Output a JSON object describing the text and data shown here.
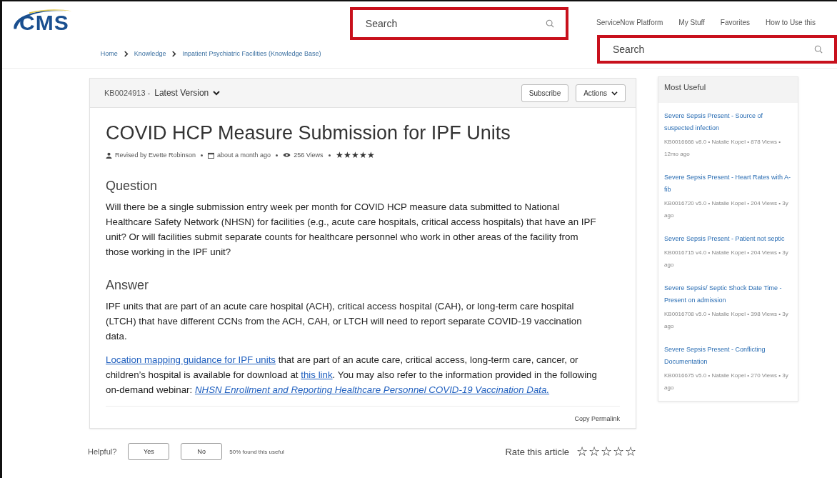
{
  "header": {
    "logo": "CMS",
    "search": {
      "placeholder": "Search"
    },
    "nav": [
      "ServiceNow Platform",
      "My Stuff",
      "Favorites",
      "How to Use this"
    ],
    "search2": {
      "placeholder": "Search"
    }
  },
  "breadcrumbs": [
    "Home",
    "Knowledge",
    "Inpatient Psychiatric Facilities (Knowledge Base)"
  ],
  "article": {
    "number": "KB0024913 -",
    "version": "Latest Version",
    "buttons": [
      "Subscribe",
      "Actions"
    ],
    "title": "COVID HCP Measure Submission for IPF Units",
    "meta": {
      "author": "Revised by Evette Robinson",
      "date": "about a month ago",
      "views": "256 Views",
      "stars": 5
    },
    "sections": [
      {
        "heading": "Question",
        "paragraphs": [
          [
            {
              "kind": "text",
              "text": "Will there be a single submission entry week per month for COVID HCP measure data submitted to National Healthcare Safety Network (NHSN) for facilities (e.g., acute care hospitals, critical access hospitals) that have an IPF unit? Or will facilities submit separate counts for healthcare personnel who work in other areas of the facility from those working in the IPF unit?"
            }
          ]
        ]
      },
      {
        "heading": "Answer",
        "paragraphs": [
          [
            {
              "kind": "text",
              "text": "IPF units that are part of an acute care hospital (ACH), critical access hospital (CAH), or long-term care hospital (LTCH) that have different CCNs from the ACH, CAH, or LTCH will need to report separate COVID-19 vaccination data."
            }
          ],
          [
            {
              "kind": "link",
              "text": "Location mapping guidance for IPF units"
            },
            {
              "kind": "text",
              "text": " that are part of an acute care, critical access, long-term care, cancer, or children’s hospital is available for download at "
            },
            {
              "kind": "link",
              "text": "this link"
            },
            {
              "kind": "text",
              "text": ". You may also refer to the information provided in the following on-demand webinar: "
            },
            {
              "kind": "italic-link",
              "text": "NHSN Enrollment and Reporting Healthcare Personnel COVID-19 Vaccination Data."
            }
          ]
        ]
      }
    ],
    "permalink": "Copy Permalink"
  },
  "feedback": {
    "label": "Helpful?",
    "buttons": [
      "Yes",
      "No"
    ],
    "note": "50% found this useful",
    "rate_label": "Rate this article",
    "stars": 0
  },
  "sidebar": {
    "title": "Most Useful",
    "items": [
      {
        "title": "Severe Sepsis Present - Source of suspected infection",
        "meta": "KB0016666 v8.0 • Natalie Kopel • 878 Views • 12mo ago"
      },
      {
        "title": "Severe Sepsis Present - Heart Rates with A-fib",
        "meta": "KB0016720 v5.0 • Natalie Kopel • 204 Views • 3y ago"
      },
      {
        "title": "Severe Sepsis Present - Patient not septic",
        "meta": "KB0016715 v4.0 • Natalie Kopel • 204 Views • 3y ago"
      },
      {
        "title": "Severe Sepsis/ Septic Shock Date Time - Present on admission",
        "meta": "KB0016708 v5.0 • Natalie Kopel • 398 Views • 3y ago"
      },
      {
        "title": "Severe Sepsis Present - Conflicting Documentation",
        "meta": "KB0016675 v5.0 • Natalie Kopel • 270 Views • 3y ago"
      }
    ]
  }
}
